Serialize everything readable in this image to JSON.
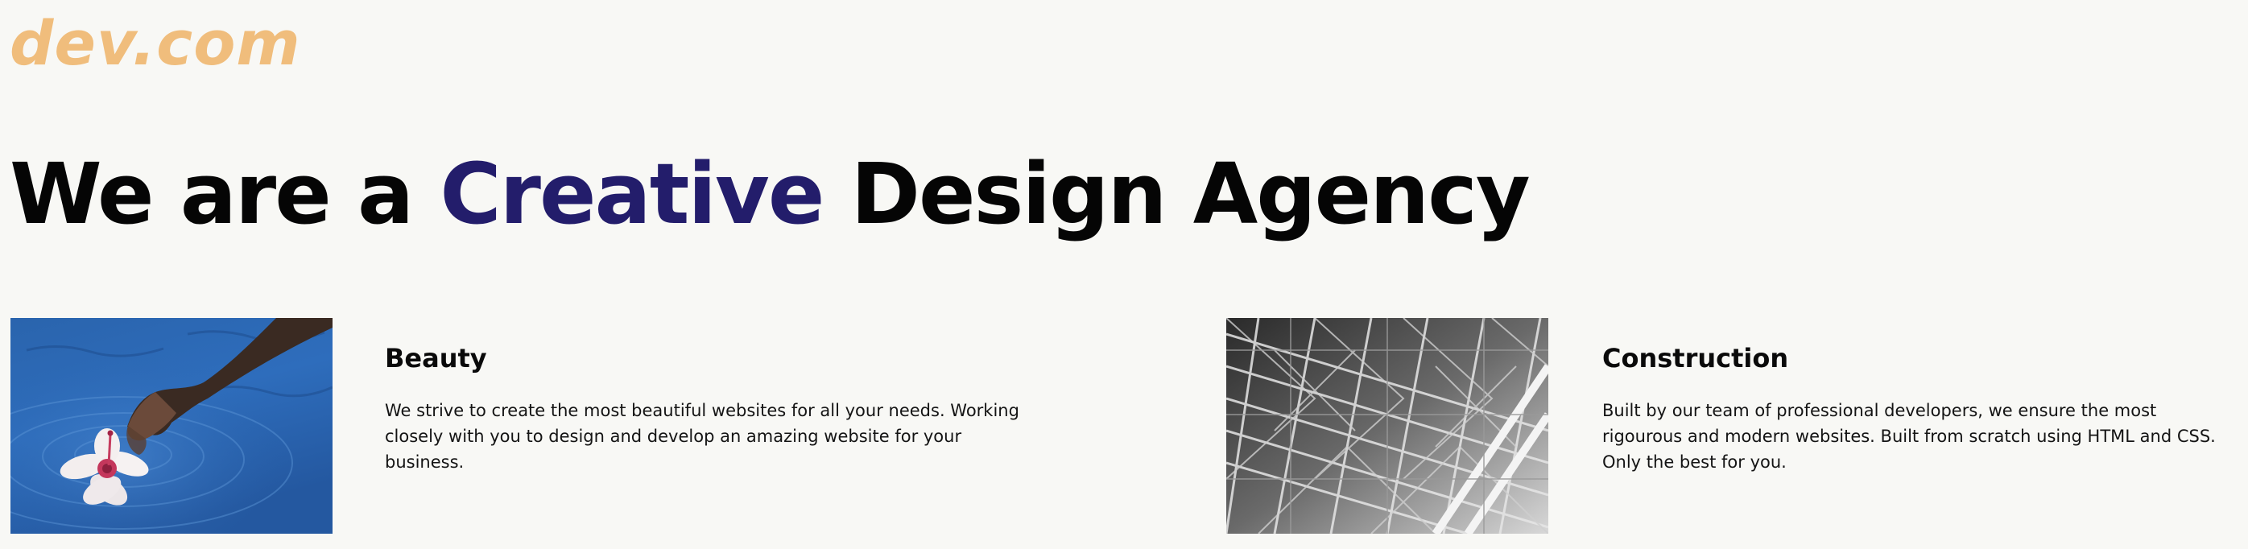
{
  "brand": {
    "logo_text": "dev.com",
    "logo_color": "#f0bd7c",
    "accent_color": "#231d6b"
  },
  "hero": {
    "headline_before": "We are a",
    "headline_accent": "Creative",
    "headline_after": "Design Agency"
  },
  "features": [
    {
      "title": "Beauty",
      "description": "We strive to create the most beautiful websites for all your needs. Working closely with you to design and develop an amazing website for your business.",
      "image": "hand-touching-water-with-flower"
    },
    {
      "title": "Construction",
      "description": "Built by our team of professional developers, we ensure the most rigourous and modern websites. Built from scratch using HTML and CSS. Only the best for you.",
      "image": "steel-lattice-structure"
    }
  ]
}
